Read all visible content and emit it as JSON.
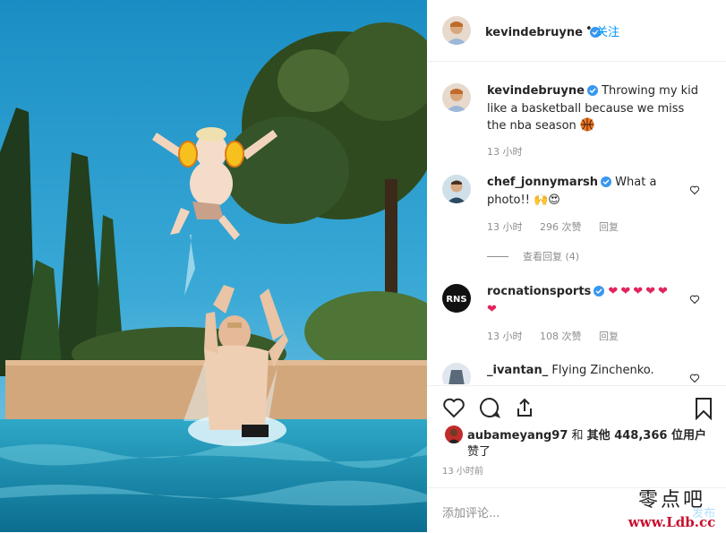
{
  "post": {
    "author": "kevindebruyne",
    "follow_label": "关注",
    "dot": "•",
    "caption": "Throwing my kid like a basketball because we miss the nba season",
    "caption_time": "13 小时",
    "photo_icon": "photo-kid-thrown-into-pool"
  },
  "comments": [
    {
      "user": "chef_jonnymarsh",
      "text": "What a photo!!",
      "emoji": "🙌😍",
      "time": "13 小时",
      "likes": "296 次赞",
      "reply": "回复",
      "view_replies": "查看回复 (4)"
    },
    {
      "user": "rocnationsports",
      "text": "",
      "emoji": "❤❤❤❤❤❤",
      "time": "13 小时",
      "likes": "108 次赞",
      "reply": "回复",
      "avatar_text": "RNS"
    },
    {
      "user": "_ivantan_",
      "text": "Flying Zinchenko."
    }
  ],
  "likes": {
    "user": "aubameyang97",
    "connector": "和",
    "others_label": "其他",
    "count": "448,366",
    "suffix": "位用户",
    "line2": "赞了",
    "posted": "13 小时前"
  },
  "add_comment": {
    "placeholder": "添加评论...",
    "post_label": "发布"
  },
  "watermark": {
    "line1": "零点吧",
    "line2": "www.Ldb.cc"
  },
  "colors": {
    "link_blue": "#0095f6",
    "verified_blue": "#3897f0",
    "heart_red": "#ed4956",
    "muted": "#8e8e8e"
  }
}
